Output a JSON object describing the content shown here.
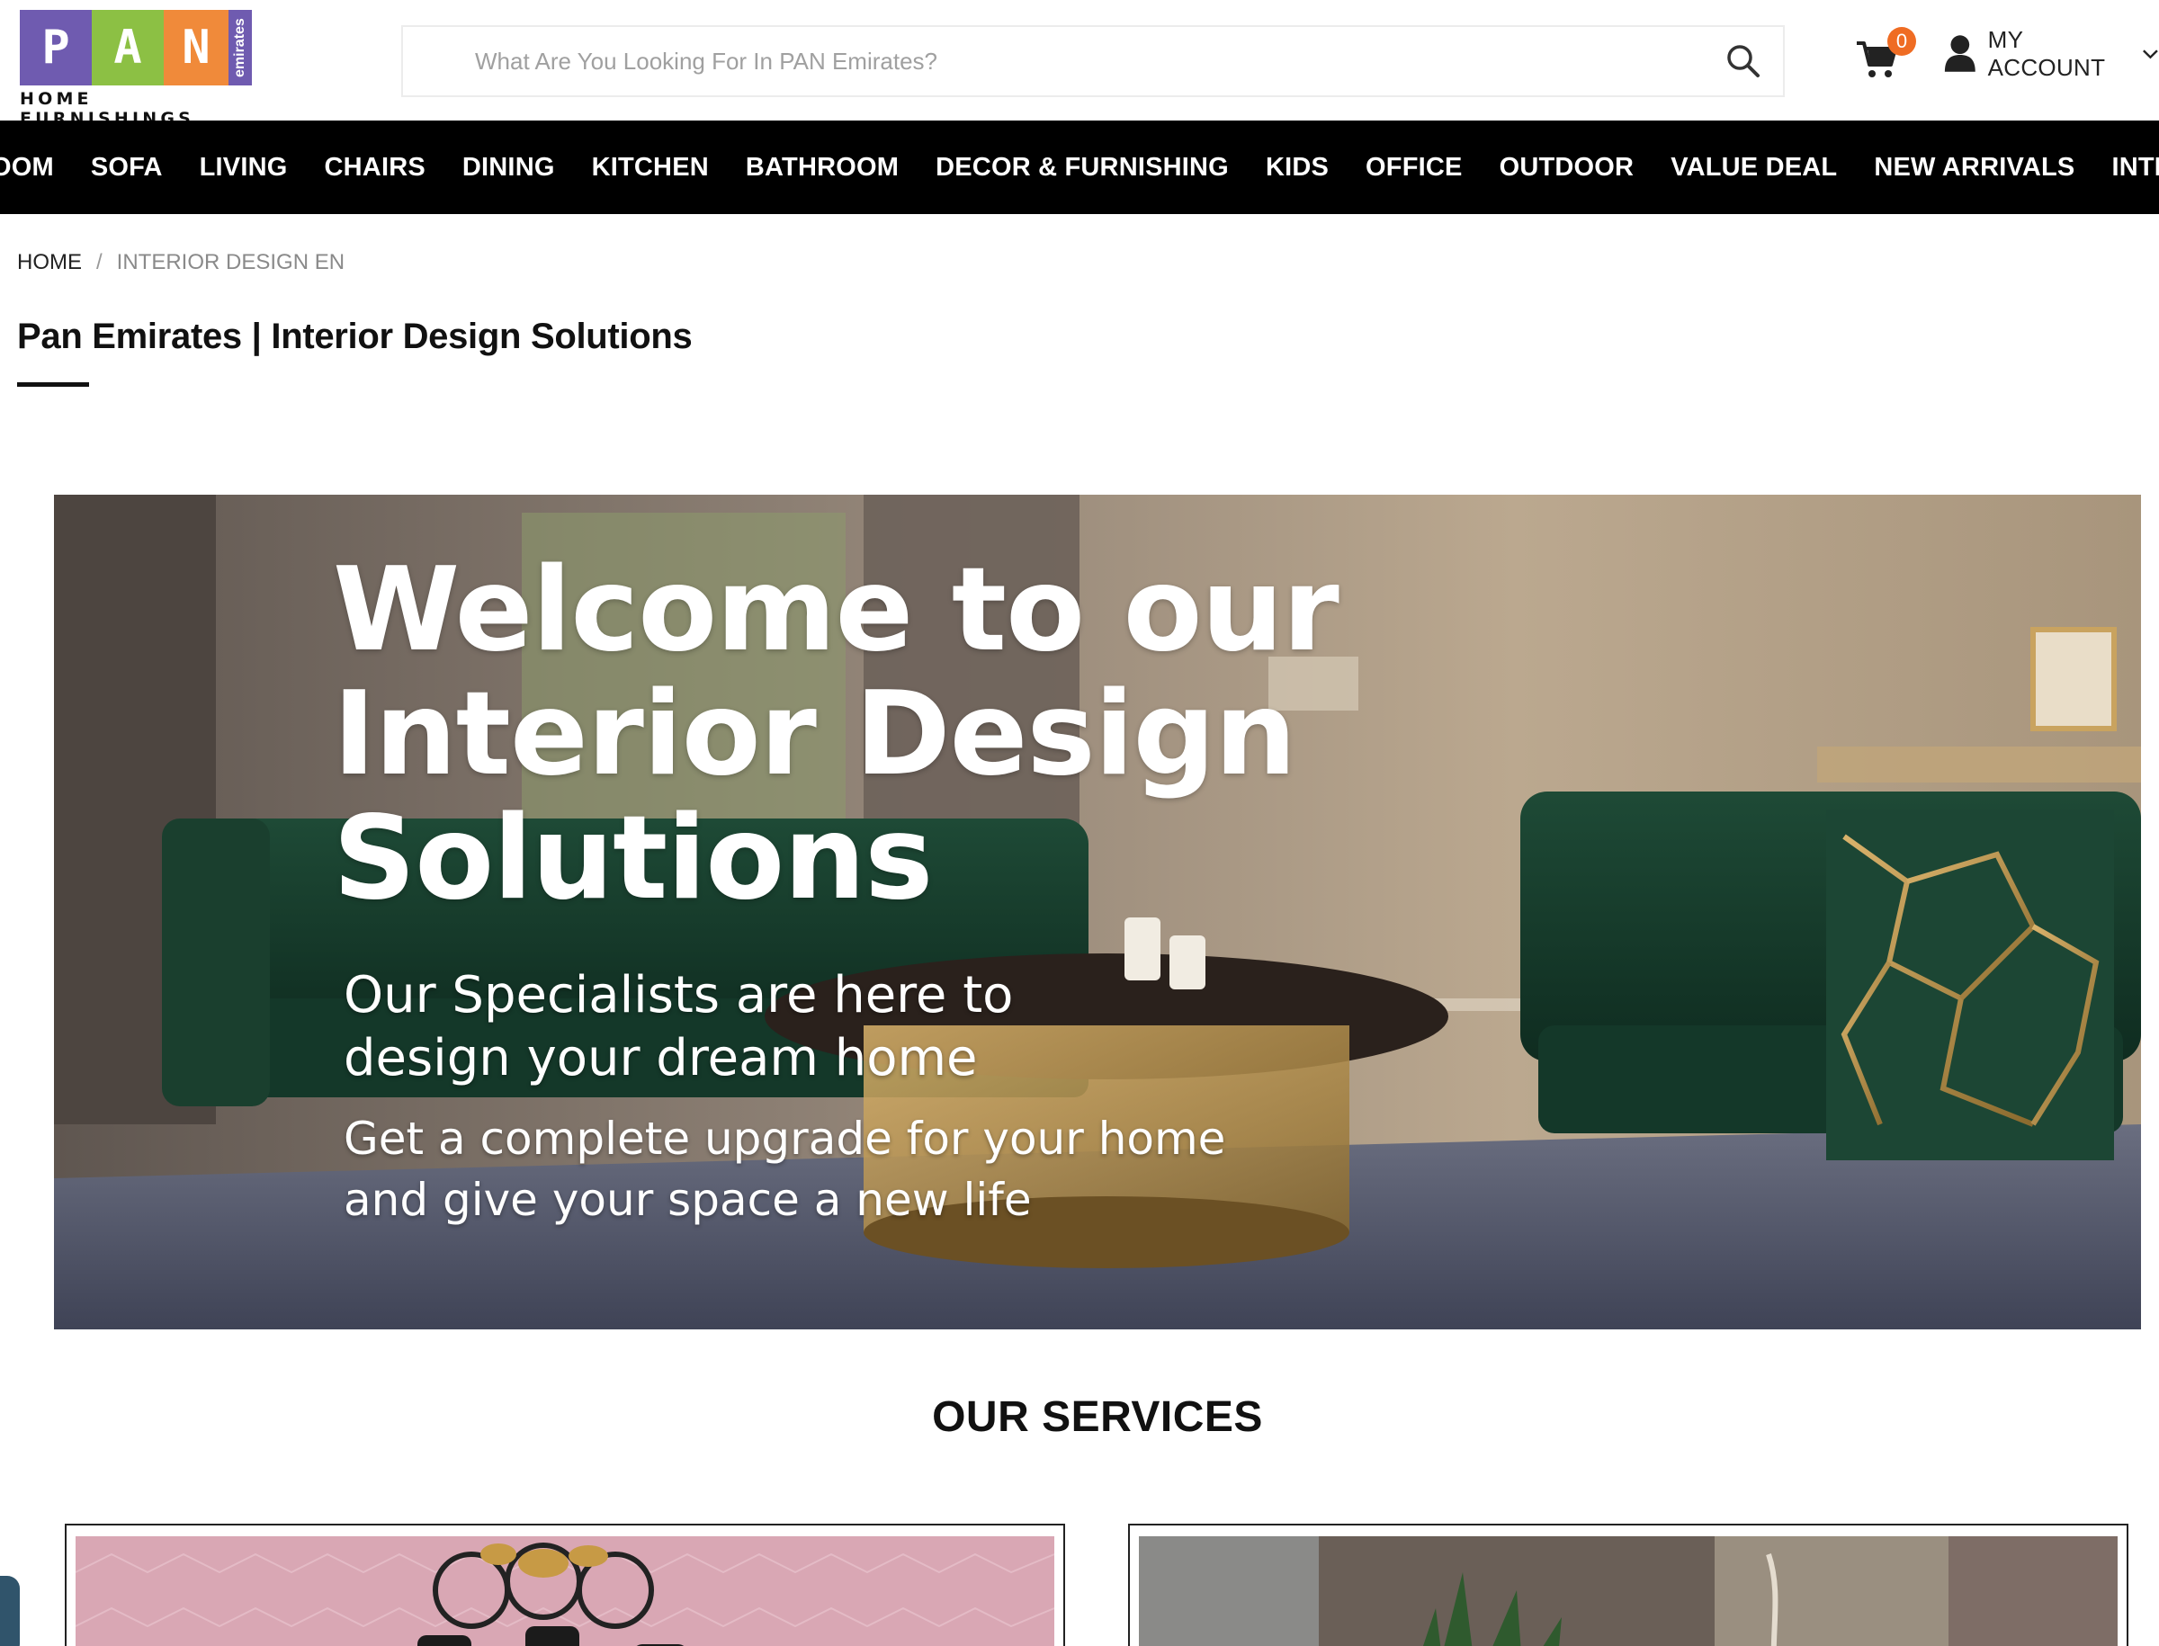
{
  "header": {
    "logo": {
      "letters": [
        "P",
        "A",
        "N"
      ],
      "side_text": "emirates",
      "tagline": "HOME FURNISHINGS"
    },
    "search": {
      "placeholder": "What Are You Looking For In PAN Emirates?",
      "value": ""
    },
    "search_icon": "search-icon",
    "cart": {
      "icon": "cart-icon",
      "count": "0"
    },
    "account": {
      "icon": "user-icon",
      "label": "MY ACCOUNT"
    }
  },
  "nav": {
    "items": [
      "OOM",
      "SOFA",
      "LIVING",
      "CHAIRS",
      "DINING",
      "KITCHEN",
      "BATHROOM",
      "DECOR & FURNISHING",
      "KIDS",
      "OFFICE",
      "OUTDOOR",
      "VALUE DEAL",
      "NEW ARRIVALS",
      "INTERIOR DE"
    ]
  },
  "breadcrumb": {
    "home": "HOME",
    "separator": "/",
    "current": "INTERIOR DESIGN EN"
  },
  "page": {
    "title": "Pan Emirates | Interior Design Solutions"
  },
  "hero": {
    "heading_line1": "Welcome to our",
    "heading_line2": "Interior Design",
    "heading_line3": "Solutions",
    "sub1": "Our Specialists are here to design your dream home",
    "sub2": "Get a complete upgrade for your home and give your space a new life"
  },
  "services": {
    "heading": "OUR SERVICES"
  },
  "colors": {
    "nav_bg": "#000000",
    "badge": "#ef6c23",
    "logo_purple": "#6f5bb0",
    "logo_green": "#8cc044",
    "logo_orange": "#f08a3a"
  }
}
